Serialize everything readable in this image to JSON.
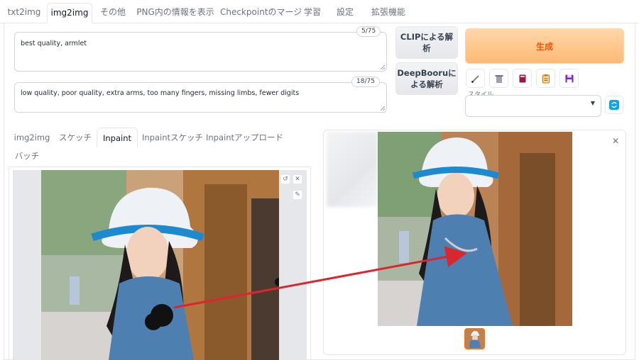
{
  "top_tabs": [
    "txt2img",
    "img2img",
    "その他",
    "PNG内の情報を表示",
    "Checkpointのマージ",
    "学習",
    "設定",
    "拡張機能"
  ],
  "prompt": {
    "positive_text": "best quality, armlet",
    "positive_counter": "5/75",
    "negative_text": "low quality, poor quality, extra arms, too many fingers, missing limbs, fewer digits",
    "negative_counter": "18/75"
  },
  "buttons": {
    "clip_line1": "CLIPによる解",
    "clip_line2": "析",
    "deepbooru_line1": "DeepBooruに",
    "deepbooru_line2": "よる解析",
    "generate": "生成"
  },
  "toolbar_icons": [
    "paint-icon",
    "trash-icon",
    "book-icon",
    "clipboard-icon",
    "save-icon"
  ],
  "style": {
    "label": "スタイル",
    "value": ""
  },
  "mode_tabs": [
    "img2img",
    "スケッチ",
    "Inpaint",
    "Inpaintスケッチ",
    "Inpaintアップロード",
    "バッチ"
  ],
  "active_mode_tab": "Inpaint",
  "active_top_tab": "img2img",
  "colors": {
    "generate_bg": "#fdba74",
    "generate_text": "#ea580c",
    "arrow": "#d9262f",
    "thumb_border": "#f97316"
  }
}
